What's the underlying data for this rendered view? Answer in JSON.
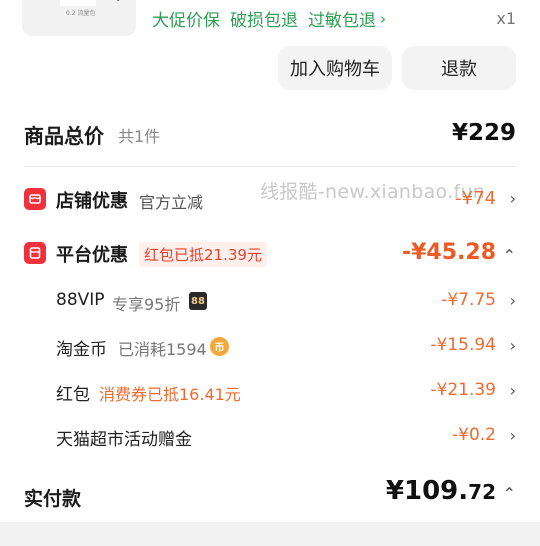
{
  "product": {
    "thumb_text": "0.2 流量包",
    "services": [
      "大促价保",
      "破损包退",
      "过敏包退"
    ],
    "services_chevron": "›",
    "quantity": "x1"
  },
  "actions": {
    "add_to_cart": "加入购物车",
    "refund": "退款"
  },
  "total": {
    "label": "商品总价",
    "count": "共1件",
    "price": "¥229"
  },
  "watermark": "线报酷-new.xianbao.fun",
  "store_discount": {
    "title": "店铺优惠",
    "sub": "官方立减",
    "amount": "-¥74",
    "chevron": "›",
    "color": "#f0303a"
  },
  "platform_discount": {
    "title": "平台优惠",
    "tag": "红包已抵21.39元",
    "amount": "-¥45.28",
    "chevron": "⌃",
    "color": "#f0303a"
  },
  "discount_rows": [
    {
      "label": "88VIP",
      "sub": "专享95折",
      "badge": "88",
      "amount": "-¥7.75",
      "chevron": "›"
    },
    {
      "label": "淘金币",
      "sub": "已消耗1594",
      "badge": "币",
      "amount": "-¥15.94",
      "chevron": "›"
    },
    {
      "label": "红包",
      "sub": "消费券已抵16.41元",
      "amount": "-¥21.39",
      "chevron": "›"
    },
    {
      "label": "天猫超市活动赠金",
      "amount": "-¥0.2",
      "chevron": "›"
    }
  ],
  "payment": {
    "label": "实付款",
    "amount_int": "¥109.",
    "amount_dec": "72",
    "chevron": "⌃"
  },
  "colors": {
    "accent_orange": "#ef6a2f",
    "service_green": "#2f9e55",
    "brand_red": "#f0303a"
  }
}
